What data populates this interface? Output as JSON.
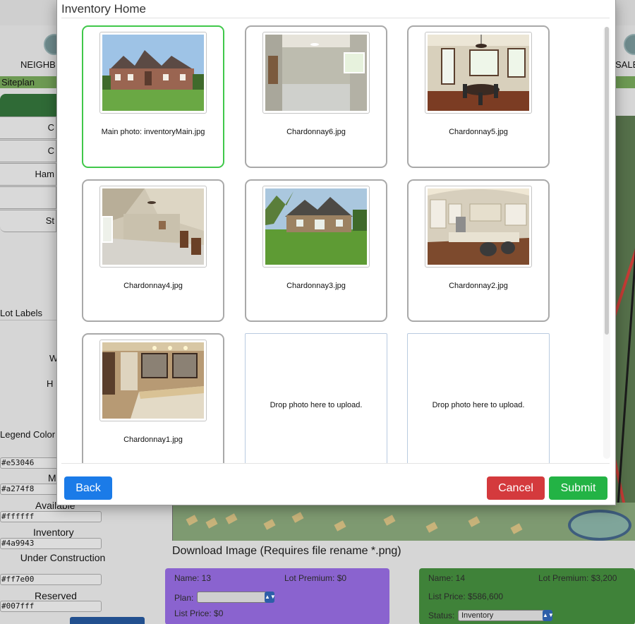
{
  "modal": {
    "title": "Inventory Home",
    "photos": [
      {
        "caption": "Main photo: inventoryMain.jpg",
        "image": "house-exterior-front",
        "is_main": true
      },
      {
        "caption": "Chardonnay6.jpg",
        "image": "empty-room"
      },
      {
        "caption": "Chardonnay5.jpg",
        "image": "dining-room"
      },
      {
        "caption": "Chardonnay4.jpg",
        "image": "bonus-room"
      },
      {
        "caption": "Chardonnay3.jpg",
        "image": "house-exterior-back"
      },
      {
        "caption": "Chardonnay2.jpg",
        "image": "kitchen"
      },
      {
        "caption": "Chardonnay1.jpg",
        "image": "bathroom"
      }
    ],
    "drop_zones": [
      {
        "text": "Drop photo here to upload."
      },
      {
        "text": "Drop photo here to upload."
      }
    ],
    "buttons": {
      "back": "Back",
      "cancel": "Cancel",
      "submit": "Submit"
    },
    "colors": {
      "back": "#1b7be8",
      "cancel": "#d43a3d",
      "submit": "#23b345",
      "main_border": "#40c84a"
    }
  },
  "background": {
    "nav": {
      "left_label": "NEIGHB",
      "right_label": "SALE"
    },
    "siteplan_label": "Siteplan",
    "side_fields": [
      "C",
      "C",
      "Ham",
      "",
      "St"
    ],
    "lot_labels": "Lot Labels",
    "side_letters": [
      "W",
      "H"
    ],
    "legend_color": "Legend Color",
    "legend": [
      {
        "label": "",
        "value": "#e53046"
      },
      {
        "label": "M",
        "value": "#a274f8"
      },
      {
        "label": "Available",
        "value": "#ffffff"
      },
      {
        "label": "Inventory",
        "value": "#4a9943"
      },
      {
        "label": "Under Construction",
        "value": "#ff7e00"
      },
      {
        "label": "Reserved",
        "value": "#007fff"
      }
    ],
    "download_text": "Download Image (Requires file rename *.png)",
    "lot_cards": [
      {
        "name": "Name: 13",
        "premium": "Lot Premium: $0",
        "plan_label": "Plan:",
        "plan_value": "",
        "price": "List Price: $0",
        "color": "#a274f8"
      },
      {
        "name": "Name: 14",
        "premium": "Lot Premium: $3,200",
        "price": "List Price: $586,600",
        "status_label": "Status:",
        "status_value": "Inventory",
        "color": "#4a9943"
      }
    ]
  }
}
